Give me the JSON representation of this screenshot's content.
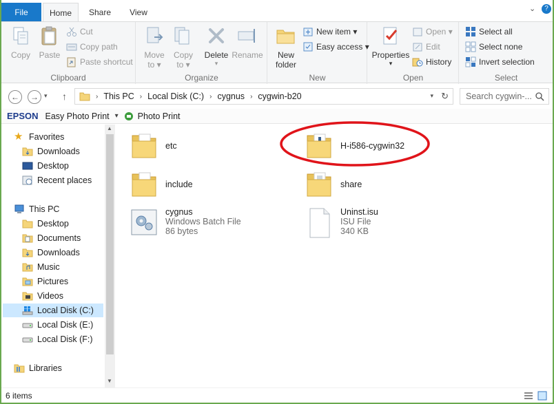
{
  "ribbon_tabs": {
    "file": "File",
    "home": "Home",
    "share": "Share",
    "view": "View"
  },
  "ribbon_controls": {
    "collapse": "⌄",
    "help": "?"
  },
  "clipboard": {
    "copy": "Copy",
    "paste": "Paste",
    "cut": "Cut",
    "copy_path": "Copy path",
    "paste_shortcut": "Paste shortcut",
    "label": "Clipboard"
  },
  "organize": {
    "move_to_1": "Move",
    "move_to_2": "to ▾",
    "copy_to_1": "Copy",
    "copy_to_2": "to ▾",
    "delete": "Delete",
    "delete_arrow": "▾",
    "rename": "Rename",
    "label": "Organize"
  },
  "new_group": {
    "new_folder_1": "New",
    "new_folder_2": "folder",
    "new_item": "New item ▾",
    "easy_access": "Easy access ▾",
    "label": "New"
  },
  "open_group": {
    "properties": "Properties",
    "properties_arrow": "▾",
    "open": "Open ▾",
    "edit": "Edit",
    "history": "History",
    "label": "Open"
  },
  "select_group": {
    "select_all": "Select all",
    "select_none": "Select none",
    "invert_selection": "Invert selection",
    "label": "Select"
  },
  "address": {
    "crumbs": [
      "This PC",
      "Local Disk (C:)",
      "cygnus",
      "cygwin-b20"
    ],
    "search_placeholder": "Search cygwin-..."
  },
  "epson_bar": {
    "brand": "EPSON",
    "easy_photo_print": "Easy Photo Print",
    "dropdown": "▾",
    "photo_print": "Photo Print"
  },
  "nav": {
    "favorites": "Favorites",
    "favorites_items": [
      "Downloads",
      "Desktop",
      "Recent places"
    ],
    "this_pc": "This PC",
    "pc_items": [
      "Desktop",
      "Documents",
      "Downloads",
      "Music",
      "Pictures",
      "Videos",
      "Local Disk (C:)",
      "Local Disk (E:)",
      "Local Disk (F:)"
    ],
    "libraries": "Libraries"
  },
  "files": [
    {
      "name": "etc"
    },
    {
      "name": "H-i586-cygwin32"
    },
    {
      "name": "include"
    },
    {
      "name": "share"
    },
    {
      "name": "cygnus",
      "type": "Windows Batch File",
      "size": "86 bytes"
    },
    {
      "name": "Uninst.isu",
      "type": "ISU File",
      "size": "340 KB"
    }
  ],
  "status": {
    "count": "6 items"
  },
  "colors": {
    "accent": "#1979ca",
    "selection": "#cce8ff",
    "annotation": "#e0141a",
    "window_border": "#6aa84f"
  }
}
